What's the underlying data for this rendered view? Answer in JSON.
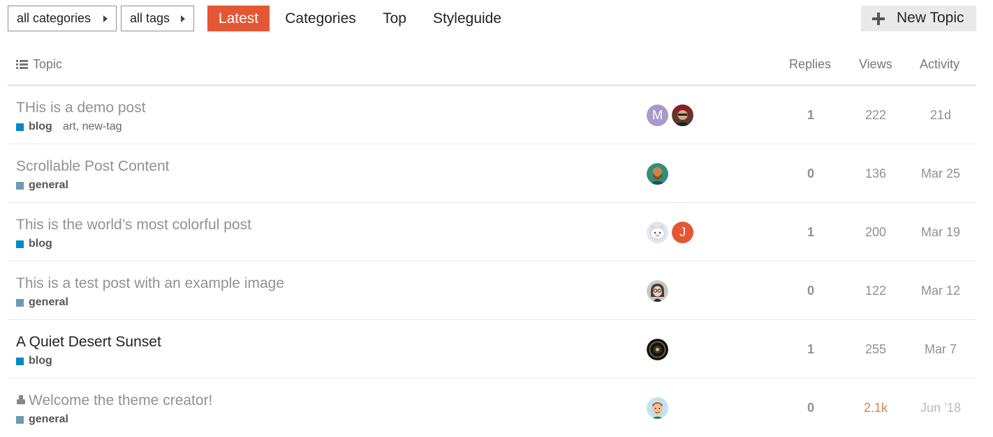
{
  "nav": {
    "category_dropdown": "all categories",
    "tag_dropdown": "all tags",
    "pills": [
      "Latest",
      "Categories",
      "Top",
      "Styleguide"
    ],
    "active_pill": "Latest",
    "new_topic": "New Topic"
  },
  "table": {
    "headers": {
      "topic": "Topic",
      "replies": "Replies",
      "views": "Views",
      "activity": "Activity"
    },
    "rows": [
      {
        "title": "THis is a demo post",
        "category": "blog",
        "tags": "art, new-tag",
        "replies": "1",
        "views": "222",
        "activity": "21d",
        "unread": false,
        "pinned": false,
        "avatars": [
          "avatar-letter-m",
          "avatar-photo"
        ]
      },
      {
        "title": "Scrollable Post Content",
        "category": "general",
        "tags": "",
        "replies": "0",
        "views": "136",
        "activity": "Mar 25",
        "unread": false,
        "pinned": false,
        "avatars": [
          "avatar-painting"
        ]
      },
      {
        "title": "This is the world’s most colorful post",
        "category": "blog",
        "tags": "",
        "replies": "1",
        "views": "200",
        "activity": "Mar 19",
        "unread": false,
        "pinned": false,
        "avatars": [
          "avatar-cat-face",
          "avatar-letter-j"
        ]
      },
      {
        "title": "This is a test post with an example image",
        "category": "general",
        "tags": "",
        "replies": "0",
        "views": "122",
        "activity": "Mar 12",
        "unread": false,
        "pinned": false,
        "avatars": [
          "avatar-glasses-woman"
        ]
      },
      {
        "title": "A Quiet Desert Sunset",
        "category": "blog",
        "tags": "",
        "replies": "1",
        "views": "255",
        "activity": "Mar 7",
        "unread": true,
        "pinned": false,
        "avatars": [
          "avatar-dark-circle"
        ]
      },
      {
        "title": "Welcome the theme creator!",
        "category": "general",
        "tags": "",
        "replies": "0",
        "views": "2.1k",
        "activity": "Jun ’18",
        "unread": false,
        "pinned": true,
        "avatars": [
          "avatar-cartoon-man"
        ]
      }
    ]
  },
  "avatar_letters": {
    "m": "M",
    "j": "J"
  },
  "colors": {
    "accent": "#e45735",
    "blog_category": "#0088cc",
    "general_category": "#6b9ab5",
    "hot_views": "#d6843f"
  }
}
